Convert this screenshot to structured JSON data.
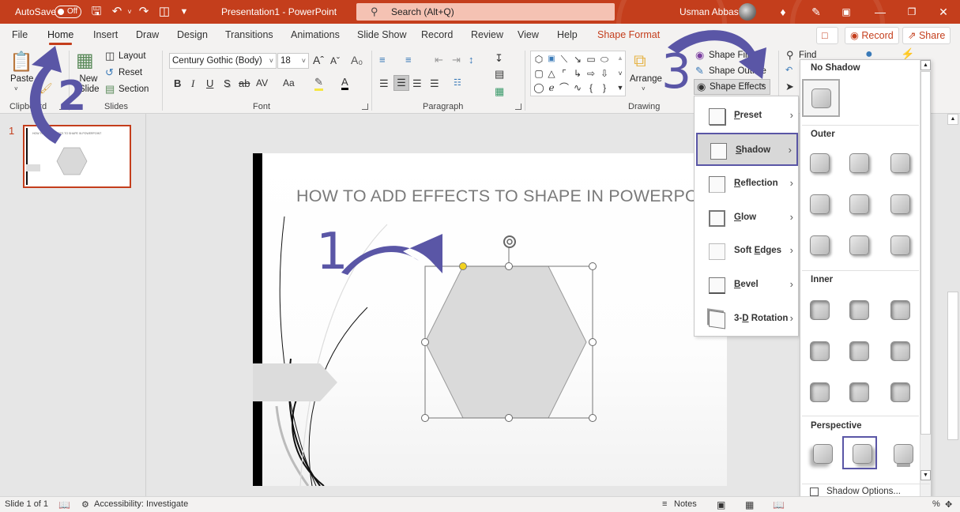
{
  "titlebar": {
    "autosave_label": "AutoSave",
    "autosave_state": "Off",
    "doc_title": "Presentation1  -  PowerPoint",
    "search_placeholder": "Search (Alt+Q)",
    "user_name": "Usman Abbasi",
    "quick_access": [
      "save-icon",
      "undo-icon",
      "redo-icon",
      "present-icon",
      "customize-icon"
    ],
    "window_controls": [
      "premium-icon",
      "pen-icon",
      "ribbon-display-icon",
      "minimize-icon",
      "restore-icon",
      "close-icon"
    ]
  },
  "menu": {
    "tabs": [
      {
        "label": "File"
      },
      {
        "label": "Home",
        "active": true
      },
      {
        "label": "Insert"
      },
      {
        "label": "Draw"
      },
      {
        "label": "Design"
      },
      {
        "label": "Transitions"
      },
      {
        "label": "Animations"
      },
      {
        "label": "Slide Show"
      },
      {
        "label": "Record"
      },
      {
        "label": "Review"
      },
      {
        "label": "View"
      },
      {
        "label": "Help"
      },
      {
        "label": "Shape Format",
        "contextual": true
      }
    ],
    "record_button": "Record",
    "share_button": "Share"
  },
  "ribbon": {
    "clipboard": {
      "paste": "Paste",
      "label": "Clipboard"
    },
    "slides": {
      "new_slide": "New Slide",
      "layout": "Layout",
      "reset": "Reset",
      "section": "Section",
      "label": "Slides"
    },
    "font": {
      "family": "Century Gothic (Body)",
      "size": "18",
      "bold": "B",
      "italic": "I",
      "underline": "U",
      "shadow": "S",
      "strike": "ab",
      "spacing": "AV",
      "case": "Aa",
      "label": "Font"
    },
    "paragraph": {
      "label": "Paragraph"
    },
    "drawing": {
      "arrange": "Arrange",
      "shape_fill": "Shape Fill",
      "shape_outline": "Shape Outline",
      "shape_effects": "Shape Effects",
      "label": "Drawing"
    },
    "editing": {
      "find": "Find"
    }
  },
  "thumbnail": {
    "number": "1",
    "title": "HOW TO ADD EFFECTS TO SHAPE IN POWERPOINT"
  },
  "slide": {
    "title": "HOW TO ADD EFFECTS TO SHAPE IN POWERPOINT"
  },
  "effects_menu": {
    "items": [
      {
        "label": "Preset",
        "accel": "P"
      },
      {
        "label": "Shadow",
        "accel": "S",
        "selected": true
      },
      {
        "label": "Reflection",
        "accel": "R"
      },
      {
        "label": "Glow",
        "accel": "G"
      },
      {
        "label": "Soft Edges",
        "accel": "E"
      },
      {
        "label": "Bevel",
        "accel": "B"
      },
      {
        "label": "3-D Rotation",
        "accel": "D"
      }
    ]
  },
  "shadow_gallery": {
    "no_shadow": "No Shadow",
    "outer": "Outer",
    "inner": "Inner",
    "perspective": "Perspective",
    "options": "Shadow Options...",
    "outer_count": 9,
    "inner_count": 9,
    "perspective_count": 3,
    "perspective_selected_index": 1
  },
  "annotations": {
    "step1": "1",
    "step2": "2",
    "step3": "3",
    "color": "#5a56a6"
  },
  "statusbar": {
    "slide_info": "Slide 1 of 1",
    "accessibility": "Accessibility: Investigate",
    "notes": "Notes",
    "zoom_suffix": "%"
  },
  "colors": {
    "brand": "#c43e1c",
    "accent": "#5a56a6"
  }
}
